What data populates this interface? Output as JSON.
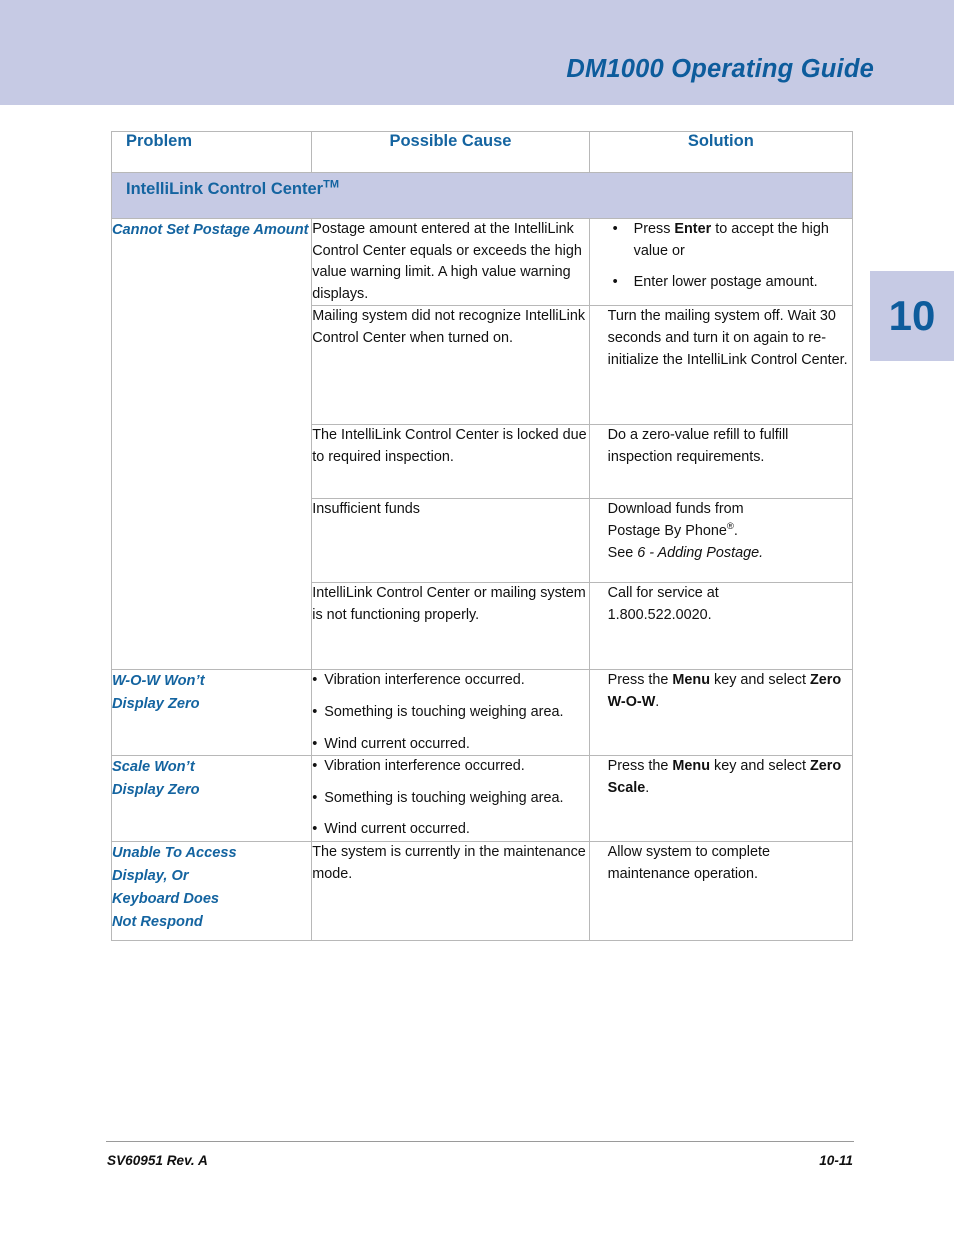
{
  "page": {
    "header_title": "DM1000 Operating Guide",
    "chapter_tab": "10",
    "footer_left": "SV60951 Rev. A",
    "footer_right": "10-11",
    "accent_blue": "#1464a0",
    "band_lavender": "#c6cae4",
    "title_blue": "#0d5c9c"
  },
  "table": {
    "headers": {
      "problem": "Problem",
      "cause": "Possible Cause",
      "solution": "Solution"
    },
    "section_title": "IntelliLink Control Center",
    "section_title_tm": "TM",
    "rows": [
      {
        "problem": "Cannot Set Postage Amount",
        "cause": "Postage amount entered at the IntelliLink Control Center equals or exceeds the high value warning limit. A high value warning displays.",
        "solution_bullets": [
          {
            "pre": "Press ",
            "bold": "Enter",
            "post": " to accept the high value or"
          },
          {
            "pre": "Enter lower postage amount.",
            "bold": "",
            "post": ""
          }
        ]
      },
      {
        "problem": "",
        "cause": "Mailing system did not recognize IntelliLink Control Center when turned on.",
        "solution": "Turn the mailing system off. Wait 30 seconds and turn it on again to re-initialize the IntelliLink Control Center."
      },
      {
        "problem": "",
        "cause": "The IntelliLink Control Center is locked due to required inspection.",
        "solution": "Do a zero-value refill to fulfill inspection requirements."
      },
      {
        "problem": "",
        "cause": "Insufficient funds",
        "solution_line1": "Download funds from",
        "solution_line2_pre": "Postage By Phone",
        "solution_line2_sup": "®",
        "solution_line2_post": ".",
        "solution_line3_pre": "See ",
        "solution_line3_italic": "6 - Adding Postage."
      },
      {
        "problem": "",
        "cause": "IntelliLink Control Center or mailing system is not functioning properly.",
        "solution_line1": "Call for service at",
        "solution_line2": "1.800.522.0020."
      },
      {
        "problem_line1": "W-O-W Won’t",
        "problem_line2": "Display  Zero",
        "cause_bullets": [
          "Vibration interference occurred.",
          "Something is touching weighing area.",
          "Wind current occurred."
        ],
        "solution_pre": "Press the ",
        "solution_bold1": "Menu",
        "solution_mid": " key and select ",
        "solution_bold2": "Zero W-O-W",
        "solution_post": "."
      },
      {
        "problem_line1": "Scale Won’t",
        "problem_line2": "Display  Zero",
        "cause_bullets": [
          "Vibration interference occurred.",
          "Something is touching weighing area.",
          "Wind current occurred."
        ],
        "solution_pre": "Press the ",
        "solution_bold1": "Menu",
        "solution_mid": " key and select ",
        "solution_bold2": "Zero Scale",
        "solution_post": "."
      },
      {
        "problem_line1": "Unable To Access",
        "problem_line2": "Display, Or",
        "problem_line3": "Keyboard Does",
        "problem_line4": "Not Respond",
        "cause": "The system is currently in the maintenance mode.",
        "solution": "Allow system to complete maintenance operation."
      }
    ]
  }
}
